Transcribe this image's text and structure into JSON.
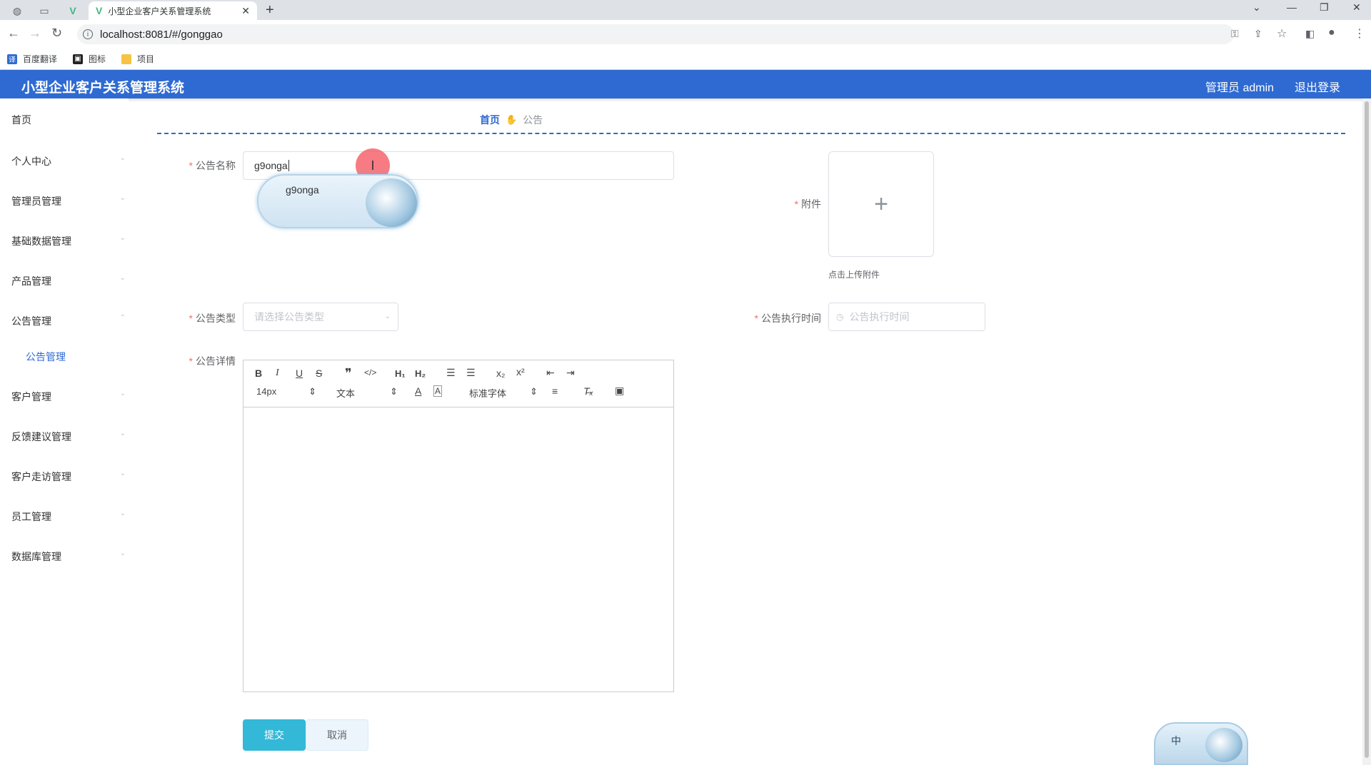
{
  "browser": {
    "tab_title": "小型企业客户关系管理系统",
    "url": "localhost:8081/#/gonggao",
    "bookmarks": [
      {
        "label": "百度翻译"
      },
      {
        "label": "图标"
      },
      {
        "label": "项目"
      }
    ]
  },
  "header": {
    "title": "小型企业客户关系管理系统",
    "user": "管理员 admin",
    "logout": "退出登录"
  },
  "sidebar": {
    "items": [
      {
        "label": "首页"
      },
      {
        "label": "个人中心"
      },
      {
        "label": "管理员管理"
      },
      {
        "label": "基础数据管理"
      },
      {
        "label": "产品管理"
      },
      {
        "label": "公告管理"
      },
      {
        "label": "客户管理"
      },
      {
        "label": "反馈建议管理"
      },
      {
        "label": "客户走访管理"
      },
      {
        "label": "员工管理"
      },
      {
        "label": "数据库管理"
      }
    ],
    "sub_item": "公告管理"
  },
  "breadcrumb": {
    "home": "首页",
    "current": "公告"
  },
  "form": {
    "name_label": "公告名称",
    "name_value": "g9onga",
    "suggestion": "g9onga",
    "attachment_label": "附件",
    "upload_hint": "点击上传附件",
    "type_label": "公告类型",
    "type_placeholder": "请选择公告类型",
    "exec_time_label": "公告执行时间",
    "exec_time_placeholder": "公告执行时间",
    "detail_label": "公告详情",
    "submit": "提交",
    "cancel": "取消"
  },
  "editor": {
    "font_size": "14px",
    "block_type": "文本",
    "font_family": "标准字体"
  },
  "ime": {
    "mode": "中"
  }
}
